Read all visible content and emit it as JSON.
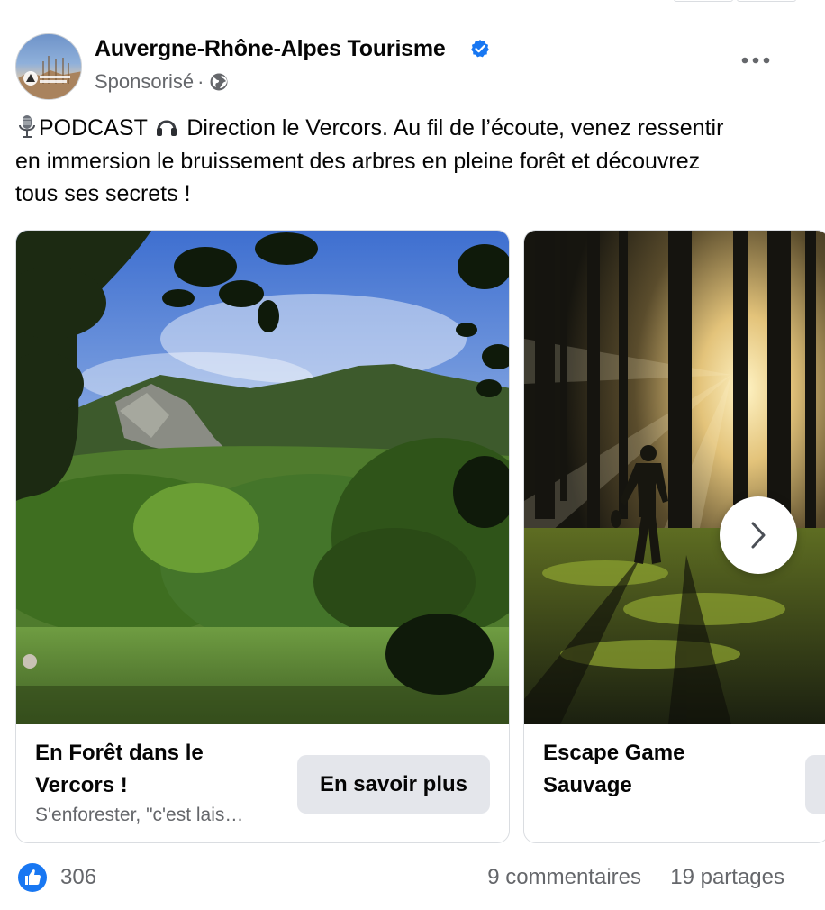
{
  "post": {
    "page_name": "Auvergne-Rhône-Alpes Tourisme",
    "sponsored_label": "Sponsorisé",
    "separator": "·",
    "text_line1_a": "PODCAST",
    "text_line1_b": "Direction le Vercors. Au fil de l’écoute, venez ressentir",
    "text_line2": "en immersion le bruissement des arbres en pleine forêt et découvrez",
    "text_line3": "tous ses secrets !",
    "icons": {
      "verified": "verified-badge-icon",
      "privacy": "globe-icon",
      "menu": "more-options-icon",
      "emoji1": "microphone-emoji",
      "emoji2": "headphones-emoji"
    },
    "colors": {
      "verified_blue": "#1877f2",
      "cta_bg": "#e4e6eb",
      "secondary_text": "#65676b"
    }
  },
  "carousel": {
    "cards": [
      {
        "title": "En Forêt dans le Vercors !",
        "subtitle": "S'enforester, \"c'est lais…",
        "cta": "En savoir plus",
        "image": "mountain-forest-meadow"
      },
      {
        "title": "Escape Game Sauvage",
        "subtitle": "",
        "cta": "",
        "image": "sunlit-forest-hiker"
      }
    ],
    "next_icon": "chevron-right-icon"
  },
  "engagement": {
    "like_count": "306",
    "comments": "9 commentaires",
    "shares": "19 partages",
    "like_icon": "thumbs-up-icon"
  }
}
